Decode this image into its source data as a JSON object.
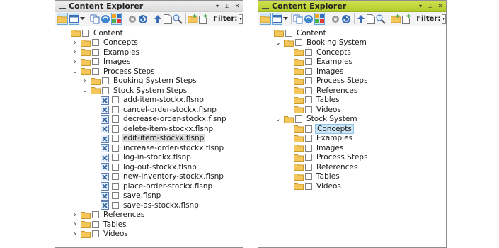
{
  "panels": [
    {
      "title": "Content Explorer",
      "title_buttons": [
        "▾",
        "⊥",
        "✕"
      ],
      "filter_label": "Filter:",
      "tree": [
        {
          "label": "Content",
          "depth": 0,
          "expand": "",
          "icon": "folder-icon"
        },
        {
          "label": "Concepts",
          "depth": 1,
          "expand": "›",
          "icon": "folder-icon"
        },
        {
          "label": "Examples",
          "depth": 1,
          "expand": "›",
          "icon": "folder-icon"
        },
        {
          "label": "Images",
          "depth": 1,
          "expand": "›",
          "icon": "folder-icon"
        },
        {
          "label": "Process Steps",
          "depth": 1,
          "expand": "⌄",
          "icon": "folder-icon"
        },
        {
          "label": "Booking System Steps",
          "depth": 2,
          "expand": "›",
          "icon": "folder-icon"
        },
        {
          "label": "Stock System Steps",
          "depth": 2,
          "expand": "⌄",
          "icon": "folder-icon"
        },
        {
          "label": "add-item-stockx.flsnp",
          "depth": 3,
          "expand": "",
          "icon": "snippet-file-icon"
        },
        {
          "label": "cancel-order-stockx.flsnp",
          "depth": 3,
          "expand": "",
          "icon": "snippet-file-icon"
        },
        {
          "label": "decrease-order-stockx.flsnp",
          "depth": 3,
          "expand": "",
          "icon": "snippet-file-icon"
        },
        {
          "label": "delete-item-stockx.flsnp",
          "depth": 3,
          "expand": "",
          "icon": "snippet-file-icon"
        },
        {
          "label": "edit-item-stockx.flsnp",
          "depth": 3,
          "expand": "",
          "icon": "snippet-file-icon",
          "selected": true
        },
        {
          "label": "increase-order-stockx.flsnp",
          "depth": 3,
          "expand": "",
          "icon": "snippet-file-icon"
        },
        {
          "label": "log-in-stockx.flsnp",
          "depth": 3,
          "expand": "",
          "icon": "snippet-file-icon"
        },
        {
          "label": "log-out-stockx.flsnp",
          "depth": 3,
          "expand": "",
          "icon": "snippet-file-icon"
        },
        {
          "label": "new-inventory-stockx.flsnp",
          "depth": 3,
          "expand": "",
          "icon": "snippet-file-icon"
        },
        {
          "label": "place-order-stockx.flsnp",
          "depth": 3,
          "expand": "",
          "icon": "snippet-file-icon"
        },
        {
          "label": "save.flsnp",
          "depth": 3,
          "expand": "",
          "icon": "snippet-file-icon"
        },
        {
          "label": "save-as-stockx.flsnp",
          "depth": 3,
          "expand": "",
          "icon": "snippet-file-icon"
        },
        {
          "label": "References",
          "depth": 1,
          "expand": "›",
          "icon": "folder-icon"
        },
        {
          "label": "Tables",
          "depth": 1,
          "expand": "›",
          "icon": "folder-icon"
        },
        {
          "label": "Videos",
          "depth": 1,
          "expand": "›",
          "icon": "folder-icon"
        }
      ]
    },
    {
      "title": "Content Explorer",
      "title_buttons": [
        "▾",
        "⊥",
        "✕"
      ],
      "filter_label": "Filter:",
      "tree": [
        {
          "label": "Content",
          "depth": 0,
          "expand": "",
          "icon": "folder-icon"
        },
        {
          "label": "Booking System",
          "depth": 1,
          "expand": "⌄",
          "icon": "folder-icon"
        },
        {
          "label": "Concepts",
          "depth": 2,
          "expand": "",
          "icon": "folder-icon"
        },
        {
          "label": "Examples",
          "depth": 2,
          "expand": "",
          "icon": "folder-icon"
        },
        {
          "label": "Images",
          "depth": 2,
          "expand": "",
          "icon": "folder-icon"
        },
        {
          "label": "Process Steps",
          "depth": 2,
          "expand": "",
          "icon": "folder-icon"
        },
        {
          "label": "References",
          "depth": 2,
          "expand": "",
          "icon": "folder-icon"
        },
        {
          "label": "Tables",
          "depth": 2,
          "expand": "",
          "icon": "folder-icon"
        },
        {
          "label": "Videos",
          "depth": 2,
          "expand": "",
          "icon": "folder-icon"
        },
        {
          "label": "Stock System",
          "depth": 1,
          "expand": "⌄",
          "icon": "folder-icon"
        },
        {
          "label": "Concepts",
          "depth": 2,
          "expand": "",
          "icon": "folder-icon",
          "selected": true
        },
        {
          "label": "Examples",
          "depth": 2,
          "expand": "",
          "icon": "folder-icon"
        },
        {
          "label": "Images",
          "depth": 2,
          "expand": "",
          "icon": "folder-icon"
        },
        {
          "label": "Process Steps",
          "depth": 2,
          "expand": "",
          "icon": "folder-icon"
        },
        {
          "label": "References",
          "depth": 2,
          "expand": "",
          "icon": "folder-icon"
        },
        {
          "label": "Tables",
          "depth": 2,
          "expand": "",
          "icon": "folder-icon"
        },
        {
          "label": "Videos",
          "depth": 2,
          "expand": "",
          "icon": "folder-icon"
        }
      ]
    }
  ],
  "colors": {
    "folder": "#f5c65a",
    "folder_edge": "#c99a2e",
    "active_titlebar": "#b9d033",
    "selection_blue": "#cde6f7",
    "selection_gray": "#dcdcdc"
  },
  "toolbar_icons": [
    "folder-view-icon",
    "layout-icon",
    "dropdown-arrow-icon",
    "copy-icon",
    "sync-icon",
    "thumbnails-icon",
    "settings-icon",
    "refresh-icon",
    "upload-icon",
    "document-icon",
    "zoom-icon",
    "new-folder-icon",
    "new-file-icon"
  ]
}
